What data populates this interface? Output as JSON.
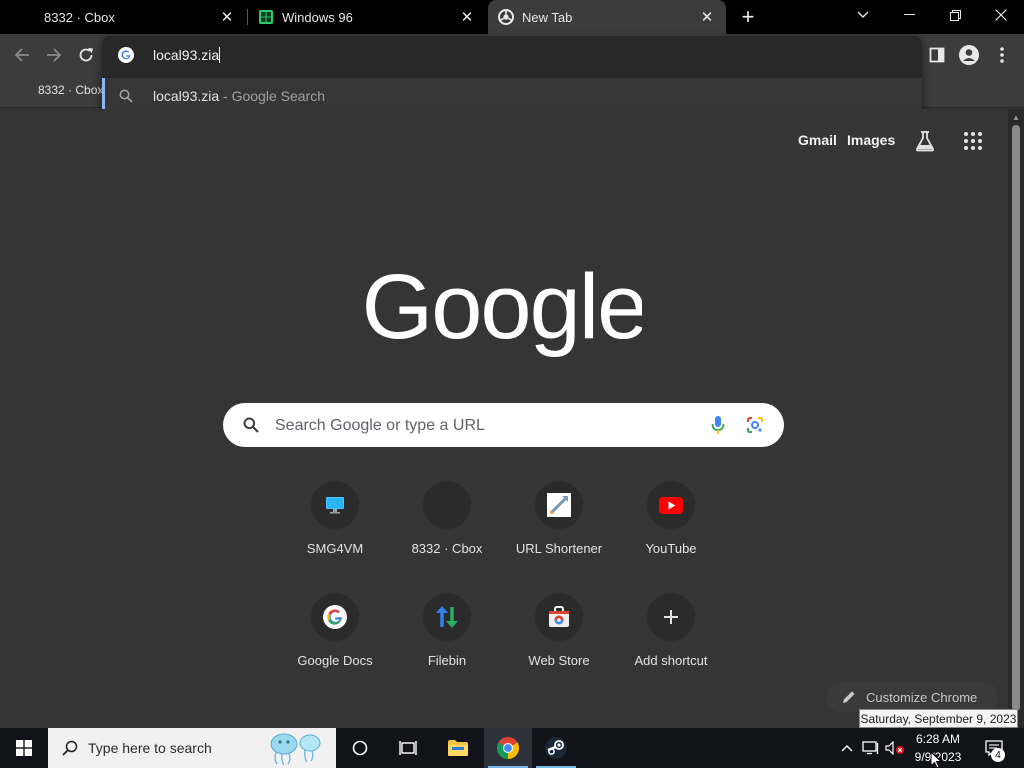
{
  "browser": {
    "tabs": [
      {
        "title": "8332 · Cbox"
      },
      {
        "title": "Windows 96"
      },
      {
        "title": "New Tab"
      }
    ],
    "omnibox": {
      "value": "local93.zia",
      "suggestion_query": "local93.zia",
      "suggestion_hint": "- Google Search"
    },
    "bookmarks": [
      {
        "label": "8332 · Cbox"
      }
    ]
  },
  "newtab": {
    "links": {
      "gmail": "Gmail",
      "images": "Images"
    },
    "search_placeholder": "Search Google or type a URL",
    "shortcuts": [
      {
        "label": "SMG4VM",
        "icon": "monitor-icon"
      },
      {
        "label": "8332 · Cbox",
        "icon": "blank-icon"
      },
      {
        "label": "URL Shortener",
        "icon": "rocket-icon"
      },
      {
        "label": "YouTube",
        "icon": "youtube-icon"
      },
      {
        "label": "Google Docs",
        "icon": "google-g-icon"
      },
      {
        "label": "Filebin",
        "icon": "transfer-arrows-icon"
      },
      {
        "label": "Web Store",
        "icon": "web-store-icon"
      },
      {
        "label": "Add shortcut",
        "icon": "plus-icon"
      }
    ],
    "customize_label": "Customize Chrome"
  },
  "taskbar": {
    "search_placeholder": "Type here to search",
    "time": "6:28 AM",
    "date": "9/9/2023",
    "tooltip": "Saturday, September 9, 2023",
    "notification_count": "4"
  },
  "colors": {
    "background": "#353535",
    "toolbar": "#3c3c3c",
    "accent": "#8ab4f8",
    "youtube_red": "#ff0000"
  }
}
